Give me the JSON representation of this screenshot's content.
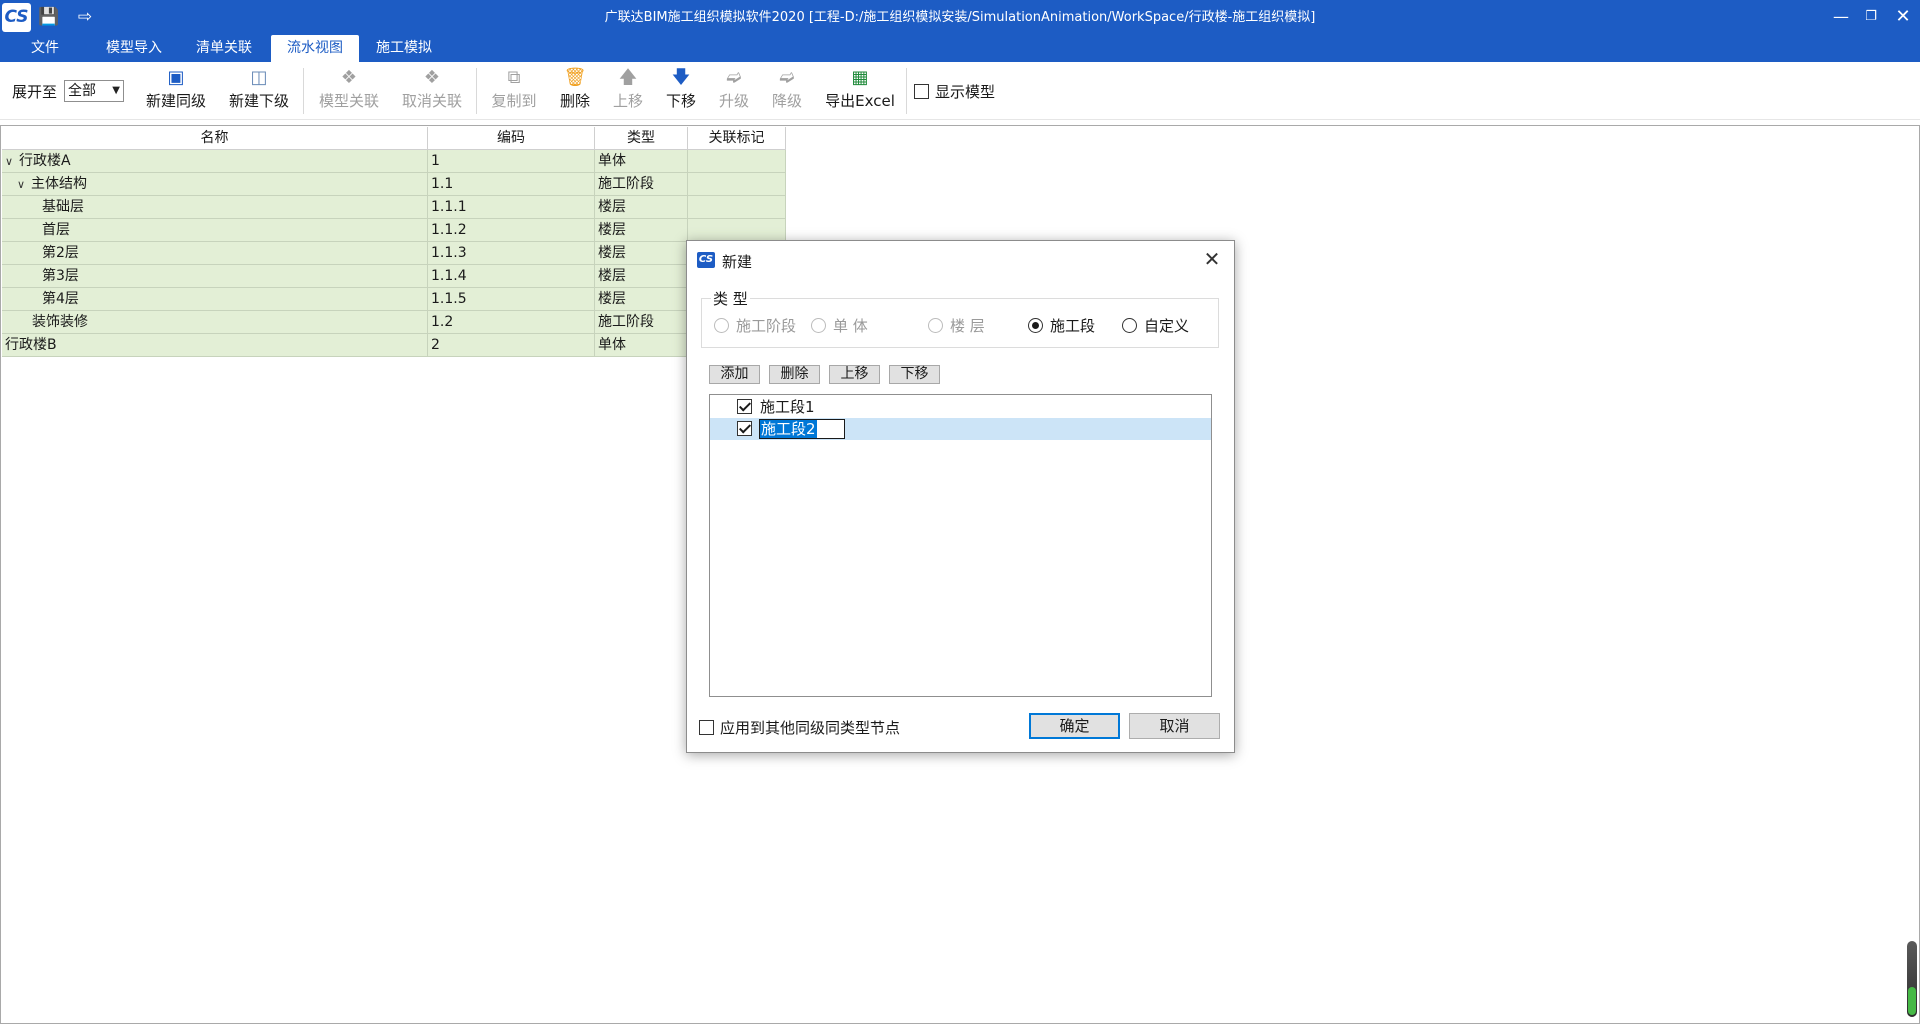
{
  "app": {
    "logo": "CS",
    "title": "广联达BIM施工组织模拟软件2020 [工程-D:/施工组织模拟安装/SimulationAnimation/WorkSpace/行政楼-施工组织模拟]"
  },
  "menu": {
    "tabs": [
      "文件",
      "模型导入",
      "清单关联",
      "流水视图",
      "施工模拟"
    ],
    "active": "流水视图"
  },
  "ribbon": {
    "expand_label": "展开至",
    "expand_value": "全部",
    "buttons": {
      "new_sibling": "新建同级",
      "new_child": "新建下级",
      "model_link": "模型关联",
      "cancel_link": "取消关联",
      "copy_to": "复制到",
      "delete": "删除",
      "move_up": "上移",
      "move_down": "下移",
      "upgrade": "升级",
      "downgrade": "降级",
      "export_excel": "导出Excel"
    },
    "show_model": "显示模型"
  },
  "grid": {
    "headers": [
      "名称",
      "编码",
      "类型",
      "关联标记"
    ],
    "rows": [
      {
        "name": "行政楼A",
        "code": "1",
        "type": "单体",
        "mark": ""
      },
      {
        "name": "主体结构",
        "code": "1.1",
        "type": "施工阶段",
        "mark": ""
      },
      {
        "name": "基础层",
        "code": "1.1.1",
        "type": "楼层",
        "mark": ""
      },
      {
        "name": "首层",
        "code": "1.1.2",
        "type": "楼层",
        "mark": ""
      },
      {
        "name": "第2层",
        "code": "1.1.3",
        "type": "楼层",
        "mark": ""
      },
      {
        "name": "第3层",
        "code": "1.1.4",
        "type": "楼层",
        "mark": ""
      },
      {
        "name": "第4层",
        "code": "1.1.5",
        "type": "楼层",
        "mark": ""
      },
      {
        "name": "装饰装修",
        "code": "1.2",
        "type": "施工阶段",
        "mark": ""
      },
      {
        "name": "行政楼B",
        "code": "2",
        "type": "单体",
        "mark": ""
      }
    ]
  },
  "dialog": {
    "title": "新建",
    "type_group_label": "类 型",
    "radios": {
      "stage": "施工阶段",
      "unit": "单 体",
      "floor": "楼 层",
      "section": "施工段",
      "custom": "自定义"
    },
    "selected_radio": "施工段",
    "buttons": {
      "add": "添加",
      "delete": "删除",
      "up": "上移",
      "down": "下移",
      "ok": "确定",
      "cancel": "取消"
    },
    "items": [
      {
        "label": "施工段1",
        "checked": true
      },
      {
        "label": "施工段2",
        "checked": true
      }
    ],
    "apply_label": "应用到其他同级同类型节点"
  },
  "colors": {
    "brand_blue": "#1d5cc4",
    "row_green": "#e3efd6",
    "selection": "#cce4f7"
  }
}
